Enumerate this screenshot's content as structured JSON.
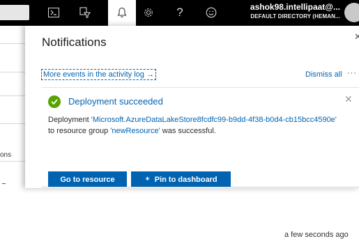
{
  "topbar": {
    "account_email": "ashok98.intellipaat@...",
    "account_directory": "DEFAULT DIRECTORY (HEMAN...",
    "icons": [
      "cloud-shell-icon",
      "directory-filter-icon",
      "bell-icon",
      "gear-icon",
      "help-icon",
      "smiley-icon"
    ],
    "help_glyph": "?"
  },
  "left_pane": {
    "partial_text": "ons"
  },
  "notifications": {
    "title": "Notifications",
    "close_glyph": "✕",
    "activity_link": "More events in the activity log →",
    "dismiss_all": "Dismiss all",
    "more_glyph": "···",
    "card": {
      "title": "Deployment succeeded",
      "close_glyph": "✕",
      "body_prefix": "Deployment ",
      "resource_link": "'Microsoft.AzureDataLakeStore8fcdfc99-b9dd-4f38-b0d4-cb15bcc4590e'",
      "body_middle": " to resource group ",
      "group_link": "'newResource'",
      "body_suffix": " was successful.",
      "go_to_resource_label": "Go to resource",
      "pin_label": "Pin to dashboard",
      "pin_glyph": "✶",
      "timestamp": "a few seconds ago"
    },
    "accent_color": "#0063b1",
    "success_color": "#57a300"
  }
}
